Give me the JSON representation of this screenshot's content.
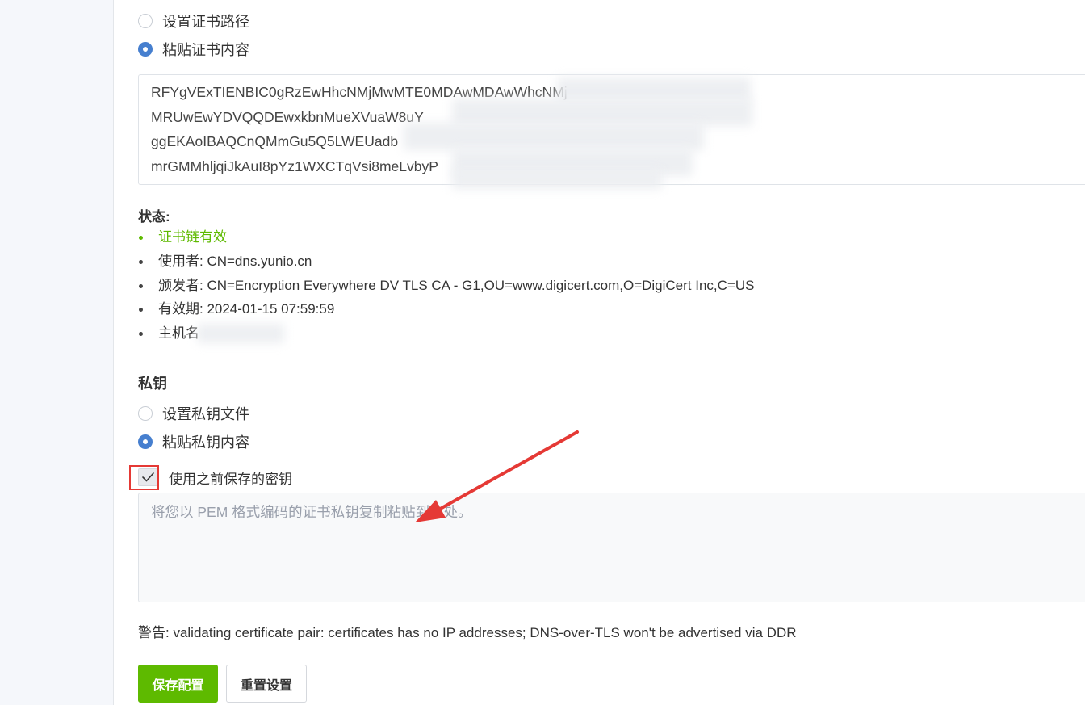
{
  "certificate": {
    "option_path": "设置证书路径",
    "option_paste": "粘贴证书内容",
    "content_lines": [
      "RFYgVExTIENBIC0gRzEwHhcNMjMwMTE0MDAwMDAwWhcNMj",
      "MRUwEwYDVQQDEwxkbnMueXVuaW8uY",
      "ggEKAoIBAQCnQMmGu5Q5LWEUadb",
      "mrGMMhljqiJkAuI8pYz1WXCTqVsi8meLvbyP"
    ]
  },
  "status": {
    "label": "状态:",
    "chain_valid": "证书链有效",
    "subject": "使用者: CN=dns.yunio.cn",
    "issuer": "颁发者: CN=Encryption Everywhere DV TLS CA - G1,OU=www.digicert.com,O=DigiCert Inc,C=US",
    "validity": "有效期: 2024-01-15 07:59:59",
    "hostname": "主机名"
  },
  "private_key": {
    "title": "私钥",
    "option_file": "设置私钥文件",
    "option_paste": "粘贴私钥内容",
    "use_saved_label": "使用之前保存的密钥",
    "use_saved_checked": true,
    "placeholder": "将您以 PEM 格式编码的证书私钥复制粘贴到此处。"
  },
  "warning": "警告: validating certificate pair: certificates has no IP addresses; DNS-over-TLS won't be advertised via DDR",
  "buttons": {
    "save": "保存配置",
    "reset": "重置设置"
  },
  "colors": {
    "primary_green": "#5eba00",
    "radio_blue": "#467fcf",
    "annotation_red": "#e53935"
  }
}
